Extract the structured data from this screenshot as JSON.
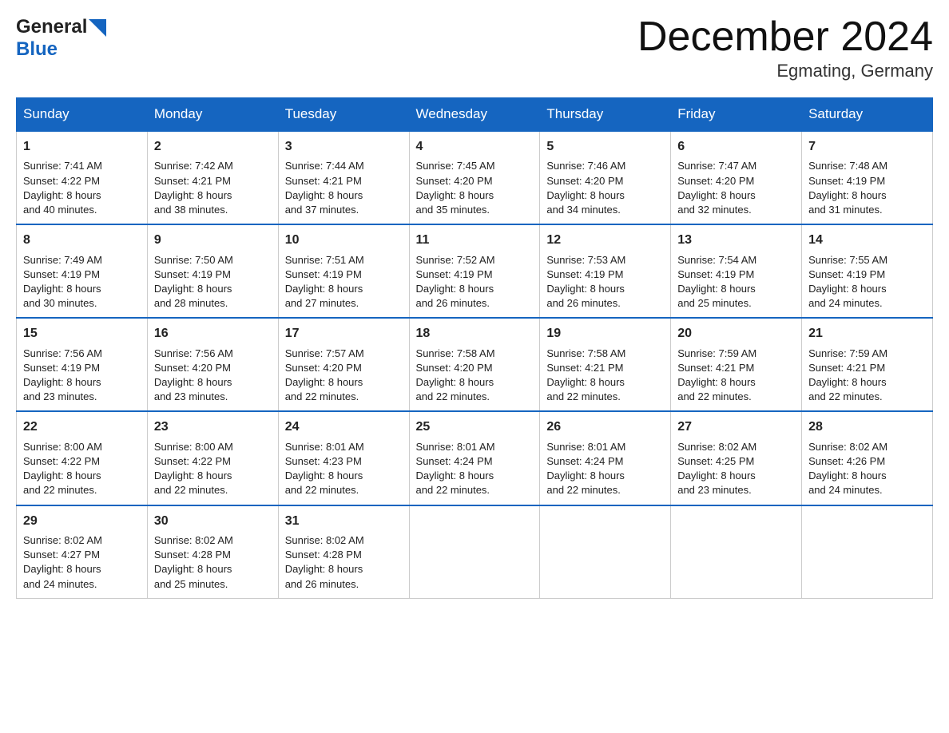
{
  "header": {
    "logo_general": "General",
    "logo_blue": "Blue",
    "month_title": "December 2024",
    "location": "Egmating, Germany"
  },
  "days_of_week": [
    "Sunday",
    "Monday",
    "Tuesday",
    "Wednesday",
    "Thursday",
    "Friday",
    "Saturday"
  ],
  "weeks": [
    [
      {
        "day": "1",
        "sunrise": "7:41 AM",
        "sunset": "4:22 PM",
        "daylight": "8 hours and 40 minutes."
      },
      {
        "day": "2",
        "sunrise": "7:42 AM",
        "sunset": "4:21 PM",
        "daylight": "8 hours and 38 minutes."
      },
      {
        "day": "3",
        "sunrise": "7:44 AM",
        "sunset": "4:21 PM",
        "daylight": "8 hours and 37 minutes."
      },
      {
        "day": "4",
        "sunrise": "7:45 AM",
        "sunset": "4:20 PM",
        "daylight": "8 hours and 35 minutes."
      },
      {
        "day": "5",
        "sunrise": "7:46 AM",
        "sunset": "4:20 PM",
        "daylight": "8 hours and 34 minutes."
      },
      {
        "day": "6",
        "sunrise": "7:47 AM",
        "sunset": "4:20 PM",
        "daylight": "8 hours and 32 minutes."
      },
      {
        "day": "7",
        "sunrise": "7:48 AM",
        "sunset": "4:19 PM",
        "daylight": "8 hours and 31 minutes."
      }
    ],
    [
      {
        "day": "8",
        "sunrise": "7:49 AM",
        "sunset": "4:19 PM",
        "daylight": "8 hours and 30 minutes."
      },
      {
        "day": "9",
        "sunrise": "7:50 AM",
        "sunset": "4:19 PM",
        "daylight": "8 hours and 28 minutes."
      },
      {
        "day": "10",
        "sunrise": "7:51 AM",
        "sunset": "4:19 PM",
        "daylight": "8 hours and 27 minutes."
      },
      {
        "day": "11",
        "sunrise": "7:52 AM",
        "sunset": "4:19 PM",
        "daylight": "8 hours and 26 minutes."
      },
      {
        "day": "12",
        "sunrise": "7:53 AM",
        "sunset": "4:19 PM",
        "daylight": "8 hours and 26 minutes."
      },
      {
        "day": "13",
        "sunrise": "7:54 AM",
        "sunset": "4:19 PM",
        "daylight": "8 hours and 25 minutes."
      },
      {
        "day": "14",
        "sunrise": "7:55 AM",
        "sunset": "4:19 PM",
        "daylight": "8 hours and 24 minutes."
      }
    ],
    [
      {
        "day": "15",
        "sunrise": "7:56 AM",
        "sunset": "4:19 PM",
        "daylight": "8 hours and 23 minutes."
      },
      {
        "day": "16",
        "sunrise": "7:56 AM",
        "sunset": "4:20 PM",
        "daylight": "8 hours and 23 minutes."
      },
      {
        "day": "17",
        "sunrise": "7:57 AM",
        "sunset": "4:20 PM",
        "daylight": "8 hours and 22 minutes."
      },
      {
        "day": "18",
        "sunrise": "7:58 AM",
        "sunset": "4:20 PM",
        "daylight": "8 hours and 22 minutes."
      },
      {
        "day": "19",
        "sunrise": "7:58 AM",
        "sunset": "4:21 PM",
        "daylight": "8 hours and 22 minutes."
      },
      {
        "day": "20",
        "sunrise": "7:59 AM",
        "sunset": "4:21 PM",
        "daylight": "8 hours and 22 minutes."
      },
      {
        "day": "21",
        "sunrise": "7:59 AM",
        "sunset": "4:21 PM",
        "daylight": "8 hours and 22 minutes."
      }
    ],
    [
      {
        "day": "22",
        "sunrise": "8:00 AM",
        "sunset": "4:22 PM",
        "daylight": "8 hours and 22 minutes."
      },
      {
        "day": "23",
        "sunrise": "8:00 AM",
        "sunset": "4:22 PM",
        "daylight": "8 hours and 22 minutes."
      },
      {
        "day": "24",
        "sunrise": "8:01 AM",
        "sunset": "4:23 PM",
        "daylight": "8 hours and 22 minutes."
      },
      {
        "day": "25",
        "sunrise": "8:01 AM",
        "sunset": "4:24 PM",
        "daylight": "8 hours and 22 minutes."
      },
      {
        "day": "26",
        "sunrise": "8:01 AM",
        "sunset": "4:24 PM",
        "daylight": "8 hours and 22 minutes."
      },
      {
        "day": "27",
        "sunrise": "8:02 AM",
        "sunset": "4:25 PM",
        "daylight": "8 hours and 23 minutes."
      },
      {
        "day": "28",
        "sunrise": "8:02 AM",
        "sunset": "4:26 PM",
        "daylight": "8 hours and 24 minutes."
      }
    ],
    [
      {
        "day": "29",
        "sunrise": "8:02 AM",
        "sunset": "4:27 PM",
        "daylight": "8 hours and 24 minutes."
      },
      {
        "day": "30",
        "sunrise": "8:02 AM",
        "sunset": "4:28 PM",
        "daylight": "8 hours and 25 minutes."
      },
      {
        "day": "31",
        "sunrise": "8:02 AM",
        "sunset": "4:28 PM",
        "daylight": "8 hours and 26 minutes."
      },
      null,
      null,
      null,
      null
    ]
  ],
  "labels": {
    "sunrise": "Sunrise:",
    "sunset": "Sunset:",
    "daylight": "Daylight:"
  }
}
